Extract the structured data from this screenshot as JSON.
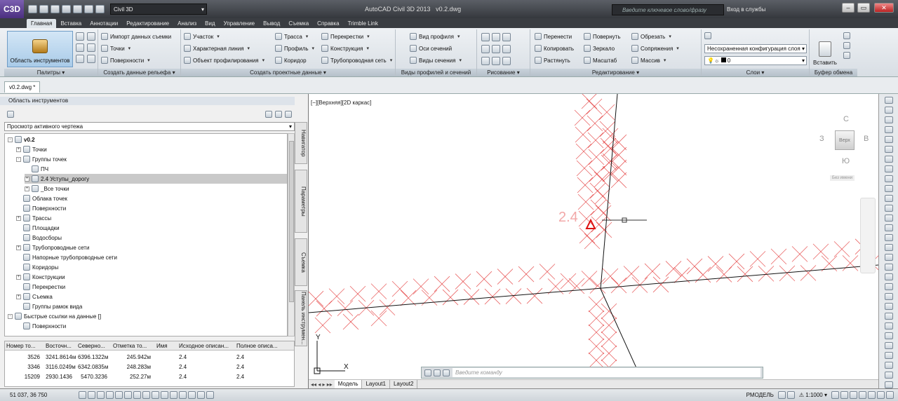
{
  "app": {
    "title": "AutoCAD Civil 3D 2013",
    "file": "v0.2.dwg",
    "logo": "C3D",
    "workspace": "Civil 3D",
    "search_placeholder": "Введите ключевое слово/фразу",
    "signin": "Вход в службы"
  },
  "ribbon_tabs": [
    "Главная",
    "Вставка",
    "Аннотации",
    "Редактирование",
    "Анализ",
    "Вид",
    "Управление",
    "Вывод",
    "Съемка",
    "Справка",
    "Trimble Link"
  ],
  "panels": {
    "palettes": {
      "title": "Палитры",
      "big_button": "Область инструментов"
    },
    "ground": {
      "title": "Создать данные рельефа",
      "items": [
        "Импорт данных съемки",
        "Точки",
        "Поверхности"
      ]
    },
    "design": {
      "title": "Создать проектные данные",
      "items": [
        "Участок",
        "Характерная линия",
        "Объект профилирования",
        "Трасса",
        "Профиль",
        "Коридор",
        "Перекрестки",
        "Конструкция",
        "Трубопроводная сеть"
      ]
    },
    "profile_views": {
      "title": "Виды профилей и сечений",
      "items": [
        "Вид профиля",
        "Оси сечений",
        "Виды сечения"
      ]
    },
    "draw": {
      "title": "Рисование"
    },
    "modify": {
      "title": "Редактирование",
      "items": [
        "Перенести",
        "Копировать",
        "Растянуть",
        "Повернуть",
        "Зеркало",
        "Масштаб",
        "Обрезать",
        "Сопряжения",
        "Массив"
      ]
    },
    "layers": {
      "title": "Слои",
      "layer_state": "Несохраненная конфигурация слоя",
      "current_layer": "0"
    },
    "clipboard": {
      "title": "Буфер обмена",
      "paste": "Вставить"
    }
  },
  "doc_tab": "v0.2.dwg *",
  "palette": {
    "title": "Область инструментов",
    "view_combo": "Просмотр активного чертежа",
    "tree": [
      {
        "label": "v0.2",
        "bold": true,
        "level": 0,
        "exp": "-"
      },
      {
        "label": "Точки",
        "level": 1,
        "exp": "+"
      },
      {
        "label": "Группы точек",
        "level": 1,
        "exp": "-"
      },
      {
        "label": "ПЧ",
        "level": 2,
        "exp": ""
      },
      {
        "label": "2.4 Уступы_дорогу",
        "level": 2,
        "exp": "+",
        "selected": true
      },
      {
        "label": "_Все точки",
        "level": 2,
        "exp": "+"
      },
      {
        "label": "Облака точек",
        "level": 1,
        "exp": ""
      },
      {
        "label": "Поверхности",
        "level": 1,
        "exp": ""
      },
      {
        "label": "Трассы",
        "level": 1,
        "exp": "+"
      },
      {
        "label": "Площадки",
        "level": 1,
        "exp": ""
      },
      {
        "label": "Водосборы",
        "level": 1,
        "exp": ""
      },
      {
        "label": "Трубопроводные сети",
        "level": 1,
        "exp": "+"
      },
      {
        "label": "Напорные трубопроводные сети",
        "level": 1,
        "exp": ""
      },
      {
        "label": "Коридоры",
        "level": 1,
        "exp": ""
      },
      {
        "label": "Конструкции",
        "level": 1,
        "exp": "+"
      },
      {
        "label": "Перекрестки",
        "level": 1,
        "exp": ""
      },
      {
        "label": "Съемка",
        "level": 1,
        "exp": "+"
      },
      {
        "label": "Группы рамок вида",
        "level": 1,
        "exp": ""
      },
      {
        "label": "Быстрые ссылки на данные []",
        "level": 0,
        "exp": "-"
      },
      {
        "label": "Поверхности",
        "level": 1,
        "exp": ""
      }
    ],
    "side_tabs": [
      "Навигатор",
      "Параметры",
      "Съемка",
      "Панель инструмен..."
    ],
    "grid": {
      "columns": [
        "Номер то...",
        "Восточн...",
        "Северно...",
        "Отметка то...",
        "Имя",
        "Исходное описан...",
        "Полное описа..."
      ],
      "rows": [
        [
          "3526",
          "3241.8614м",
          "6396.1322м",
          "245.942м",
          "",
          "2.4",
          "2.4"
        ],
        [
          "3346",
          "3116.0249м",
          "6342.0835м",
          "248.283м",
          "",
          "2.4",
          "2.4"
        ],
        [
          "15209",
          "2930.1436",
          "5470.3236",
          "252.27м",
          "",
          "2.4",
          "2.4"
        ]
      ]
    }
  },
  "viewport": {
    "label": "[−][Верхняя][2D каркас]",
    "point_label": "2.4",
    "viewcube": {
      "top": "Верх",
      "north": "С",
      "south": "Ю",
      "west": "З",
      "east": "В",
      "wcs": "Без имени"
    },
    "axis_y": "Y",
    "axis_x": "X",
    "layout_tabs": [
      "Модель",
      "Layout1",
      "Layout2"
    ],
    "command_placeholder": "Введите команду"
  },
  "status": {
    "coords": "51 037, 36 750",
    "model": "РМОДЕЛЬ",
    "scale": "1:1000"
  },
  "colors": {
    "marker": "#e23030",
    "ribbon_active": "#a9cbe8"
  }
}
